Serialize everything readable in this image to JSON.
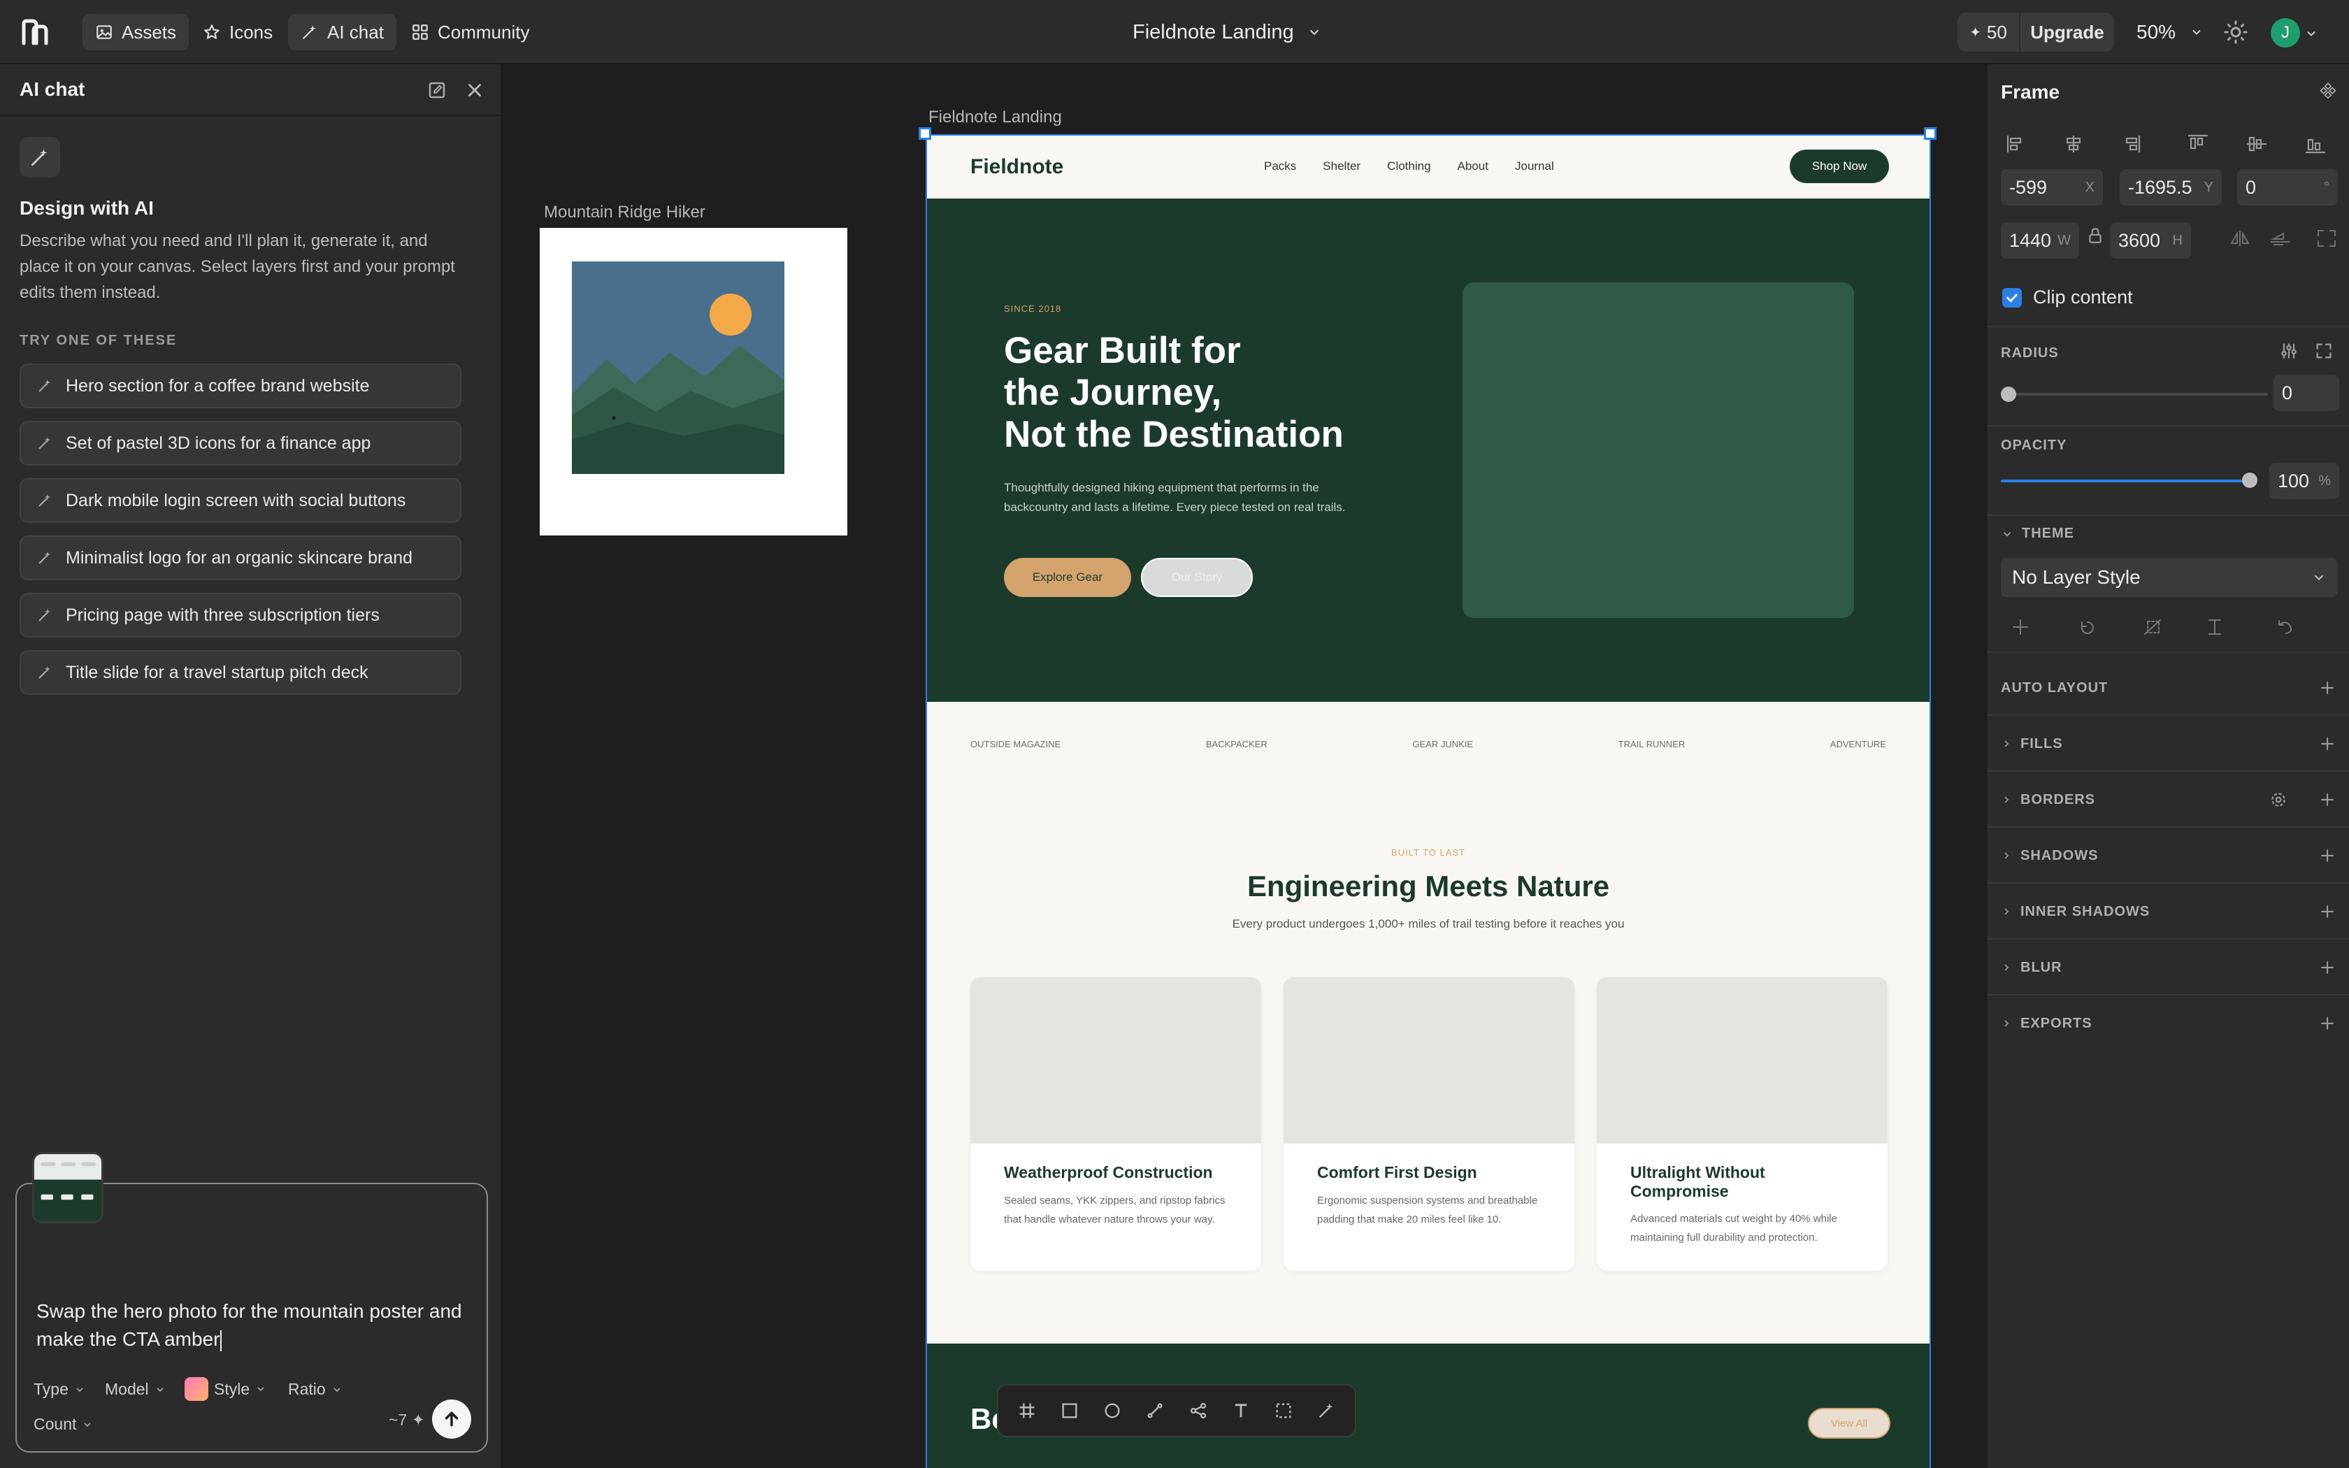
{
  "topbar": {
    "nav": [
      {
        "label": "Assets",
        "icon": "image-icon",
        "active": true
      },
      {
        "label": "Icons",
        "icon": "star-icon",
        "active": false
      },
      {
        "label": "AI chat",
        "icon": "wand-icon",
        "active": true
      },
      {
        "label": "Community",
        "icon": "grid-icon",
        "active": false
      }
    ],
    "document_title": "Fieldnote Landing",
    "credits": "50",
    "upgrade_label": "Upgrade",
    "zoom": "50%",
    "avatar_initial": "J"
  },
  "ai_chat": {
    "title": "AI chat",
    "heading": "Design with AI",
    "description": "Describe what you need and I'll plan it, generate it, and place it on your canvas. Select layers first and your prompt edits them instead.",
    "try_heading": "TRY ONE OF THESE",
    "suggestions": [
      "Hero section for a coffee brand website",
      "Set of pastel 3D icons for a finance app",
      "Dark mobile login screen with social buttons",
      "Minimalist logo for an organic skincare brand",
      "Pricing page with three subscription tiers",
      "Title slide for a travel startup pitch deck"
    ],
    "prompt": "Swap the hero photo for the mountain poster and make the CTA amber",
    "options": {
      "type": "Type",
      "model": "Model",
      "style": "Style",
      "ratio": "Ratio",
      "count": "Count"
    },
    "cost": "~7"
  },
  "canvas": {
    "poster_label": "Mountain Ridge Hiker",
    "frame_label": "Fieldnote Landing",
    "landing": {
      "brand": "Fieldnote",
      "nav_links": [
        "Packs",
        "Shelter",
        "Clothing",
        "About",
        "Journal"
      ],
      "shop_button": "Shop Now",
      "since": "SINCE 2018",
      "hero_title_lines": [
        "Gear Built for",
        "the Journey,",
        "Not the Destination"
      ],
      "hero_text": "Thoughtfully designed hiking equipment that performs in the backcountry and lasts a lifetime. Every piece tested on real trails.",
      "explore_button": "Explore Gear",
      "story_button": "Our Story",
      "press": [
        "OUTSIDE MAGAZINE",
        "BACKPACKER",
        "GEAR JUNKIE",
        "TRAIL RUNNER",
        "ADVENTURE"
      ],
      "built_label": "BUILT TO LAST",
      "section_title": "Engineering Meets Nature",
      "section_sub": "Every product undergoes 1,000+ miles of trail testing before it reaches you",
      "cards": [
        {
          "title": "Weatherproof Construction",
          "desc": "Sealed seams, YKK zippers, and ripstop fabrics that handle whatever nature throws your way."
        },
        {
          "title": "Comfort First Design",
          "desc": "Ergonomic suspension systems and breathable padding that make 20 miles feel like 10."
        },
        {
          "title": "Ultralight Without Compromise",
          "desc": "Advanced materials cut weight by 40% while maintaining full durability and protection."
        }
      ],
      "bottom_heading": "Be",
      "view_all": "View All"
    },
    "colors": {
      "forest": "#1b3a2c",
      "amber": "#d4a36e",
      "selection": "#2b7fe6"
    }
  },
  "inspector": {
    "title": "Frame",
    "x": "-599",
    "x_label": "X",
    "y": "-1695.5",
    "y_label": "Y",
    "rotation": "0",
    "rotation_unit": "°",
    "w": "1440",
    "w_label": "W",
    "h": "3600",
    "h_label": "H",
    "clip_content": "Clip content",
    "radius_label": "RADIUS",
    "radius_value": "0",
    "opacity_label": "OPACITY",
    "opacity_value": "100",
    "opacity_unit": "%",
    "opacity_level": 1.0,
    "theme_label": "THEME",
    "theme_value": "No Layer Style",
    "sections": [
      "AUTO LAYOUT",
      "FILLS",
      "BORDERS",
      "SHADOWS",
      "INNER SHADOWS",
      "BLUR",
      "EXPORTS"
    ]
  }
}
